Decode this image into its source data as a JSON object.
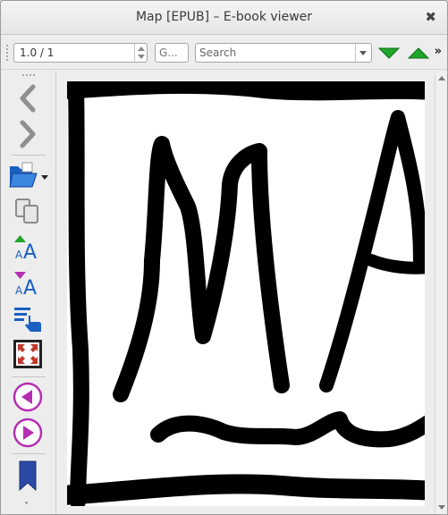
{
  "window": {
    "title": "Map [EPUB] – E-book viewer",
    "close_glyph": "✖"
  },
  "toolbar": {
    "position_value": "1.0 / 1",
    "goto_label": "G...",
    "search_placeholder": "Search",
    "find_next_icon": "green-down-triangle-icon",
    "find_prev_icon": "green-up-triangle-icon",
    "overflow_glyph": "»",
    "accent_green": "#1fa52b"
  },
  "sidebar": {
    "icons": [
      "back-arrow-icon",
      "forward-arrow-icon",
      "open-folder-icon",
      "copy-icon",
      "font-larger-icon",
      "font-smaller-icon",
      "table-of-contents-icon",
      "fullscreen-icon",
      "previous-page-icon",
      "next-page-icon",
      "bookmark-icon"
    ],
    "more_glyph": "˅",
    "accent_magenta": "#b42fb2",
    "accent_blue": "#1a5fc4"
  }
}
